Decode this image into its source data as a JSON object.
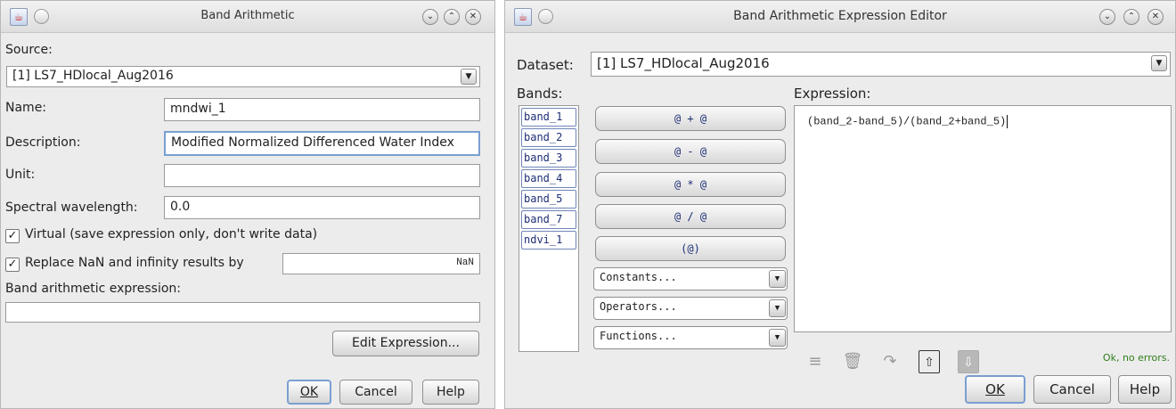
{
  "left_dialog": {
    "title": "Band Arithmetic",
    "source_label": "Source:",
    "source_value": "[1] LS7_HDlocal_Aug2016",
    "name_label": "Name:",
    "name_value": "mndwi_1",
    "description_label": "Description:",
    "description_value": "Modified Normalized Differenced Water Index",
    "unit_label": "Unit:",
    "unit_value": "",
    "wavelength_label": "Spectral wavelength:",
    "wavelength_value": "0.0",
    "virtual_label": "Virtual (save expression only, don't write data)",
    "virtual_checked": true,
    "replace_label": "Replace NaN and infinity results by",
    "replace_checked": true,
    "replace_value": "NaN",
    "expression_label": "Band arithmetic expression:",
    "expression_value": "",
    "edit_button": "Edit Expression...",
    "ok_button": "OK",
    "cancel_button": "Cancel",
    "help_button": "Help"
  },
  "right_dialog": {
    "title": "Band Arithmetic Expression Editor",
    "dataset_label": "Dataset:",
    "dataset_value": "[1] LS7_HDlocal_Aug2016",
    "bands_label": "Bands:",
    "bands": [
      "band_1",
      "band_2",
      "band_3",
      "band_4",
      "band_5",
      "band_7",
      "ndvi_1"
    ],
    "operators": [
      "@ + @",
      "@ - @",
      "@ * @",
      "@ / @",
      "(@)"
    ],
    "constants_label": "Constants...",
    "operators_label": "Operators...",
    "functions_label": "Functions...",
    "expression_label": "Expression:",
    "expression_value": "(band_2-band_5)/(band_2+band_5)",
    "status": "Ok, no errors.",
    "ok_button": "OK",
    "cancel_button": "Cancel",
    "help_button": "Help"
  },
  "icons": {
    "app": "java-icon",
    "close": "close-icon",
    "maximize": "chevron-up-icon",
    "minimize": "chevron-down-icon"
  },
  "colors": {
    "window_bg": "#ececec",
    "default_button_border": "#7a9fd1",
    "band_text": "#1d2e74",
    "status_ok": "#2f7d1a"
  }
}
